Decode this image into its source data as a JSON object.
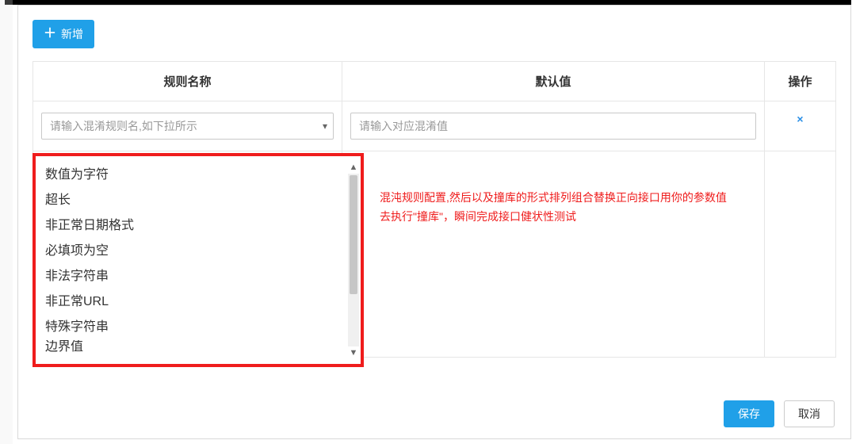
{
  "toolbar": {
    "add_label": "新增"
  },
  "table": {
    "headers": {
      "name": "规则名称",
      "default": "默认值",
      "action": "操作"
    },
    "row": {
      "name_placeholder": "请输入混淆规则名,如下拉所示",
      "value_placeholder": "请输入对应混淆值",
      "delete_symbol": "×"
    }
  },
  "dropdown": {
    "options": [
      "数值为字符",
      "超长",
      "非正常日期格式",
      "必填项为空",
      "非法字符串",
      "非正常URL",
      "特殊字符串",
      "边界值"
    ],
    "scroll_up": "▲",
    "scroll_down": "▼"
  },
  "annotation": {
    "line1": "混沌规则配置,然后以及撞库的形式排列组合替换正向接口用你的参数值",
    "line2": "去执行\"撞库\"，瞬间完成接口健状性测试"
  },
  "footer": {
    "save": "保存",
    "cancel": "取消"
  }
}
